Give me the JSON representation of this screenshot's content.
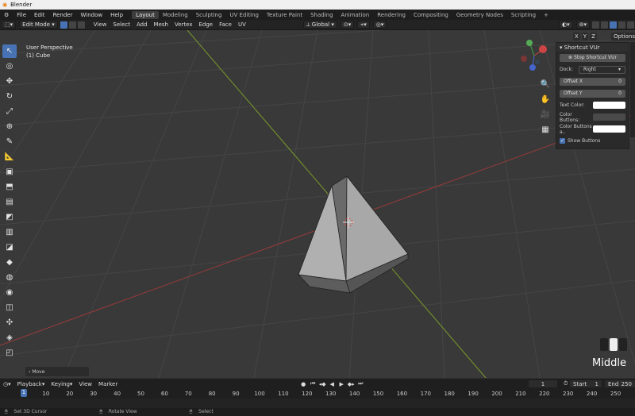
{
  "window": {
    "title": "Blender"
  },
  "menu": [
    "File",
    "Edit",
    "Render",
    "Window",
    "Help"
  ],
  "workspaces": [
    "Layout",
    "Modeling",
    "Sculpting",
    "UV Editing",
    "Texture Paint",
    "Shading",
    "Animation",
    "Rendering",
    "Compositing",
    "Geometry Nodes",
    "Scripting"
  ],
  "active_workspace": "Layout",
  "header": {
    "mode": "Edit Mode",
    "menus": [
      "View",
      "Select",
      "Add",
      "Mesh",
      "Vertex",
      "Edge",
      "Face",
      "UV"
    ],
    "orientation": "Global"
  },
  "viewport": {
    "perspective": "User Perspective",
    "object": "(1) Cube",
    "options": "Options",
    "axes": [
      "X",
      "Y",
      "Z"
    ]
  },
  "npanel": {
    "title": "Shortcut VUr",
    "stop_button": "Stop Shortcut VUr",
    "dock_label": "Dock:",
    "dock_value": "Right",
    "offset_x_label": "Offset X",
    "offset_x_value": "0",
    "offset_y_label": "Offset Y",
    "offset_y_value": "0",
    "text_color_label": "Text Color:",
    "color_buttons_label": "Color Buttons:",
    "color_buttons_a_label": "Color Buttons a..",
    "show_buttons_label": "Show Buttons"
  },
  "last_operator": "Move",
  "key_hint": "Middle",
  "timeline": {
    "menus": [
      "Playback",
      "Keying",
      "View",
      "Marker"
    ],
    "current_frame": "1",
    "start_label": "Start",
    "start": "1",
    "end_label": "End",
    "end": "250",
    "ticks": [
      "0",
      "10",
      "20",
      "30",
      "40",
      "50",
      "60",
      "70",
      "80",
      "90",
      "100",
      "110",
      "120",
      "130",
      "140",
      "150",
      "160",
      "170",
      "180",
      "190",
      "200",
      "210",
      "220",
      "230",
      "240",
      "250"
    ],
    "playhead": "1"
  },
  "statusbar": [
    "Set 3D Cursor",
    "Rotate View",
    "Select"
  ],
  "colors": {
    "accent": "#4772b3",
    "x_axis": "#9a3a3a",
    "y_axis": "#7a9a2a"
  }
}
